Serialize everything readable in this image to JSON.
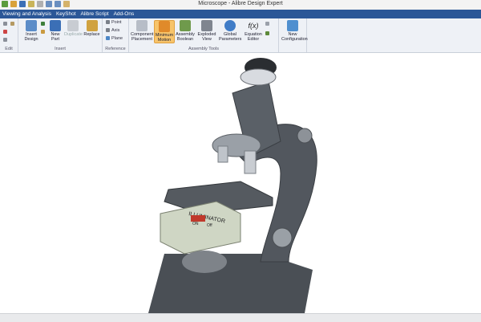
{
  "window": {
    "title": "Microscope - Alibre Design Expert"
  },
  "menu": [
    "Viewing and Analysis",
    "KeyShot",
    "Alibre Script",
    "Add-Ons"
  ],
  "ribbon": {
    "groups": {
      "edit": "Edit",
      "insert": "Insert",
      "reference": "Reference",
      "assembly_tools": "Assembly Tools"
    },
    "insert_design": "Insert Design",
    "new_part": "New Part",
    "duplicate": "Duplicate",
    "replace": "Replace",
    "point": "Point",
    "axis": "Axis",
    "plane": "Plane",
    "component_placement": "Component Placement",
    "minimum_motion": "Minimum Motion",
    "assembly_boolean": "Assembly Boolean",
    "exploded_view": "Exploded View",
    "global_parameters": "Global Parameters",
    "equation_editor": "Equation Editor",
    "equation_symbol": "f(x)",
    "new_configuration": "New Configuration"
  },
  "model": {
    "illuminator": "ILLUMINATOR",
    "on": "ON",
    "off": "Off"
  },
  "colors": {
    "accent": "#2b5797",
    "body": "#4a4f55",
    "stage": "#cfd6c4",
    "active": "#f7c46b"
  }
}
